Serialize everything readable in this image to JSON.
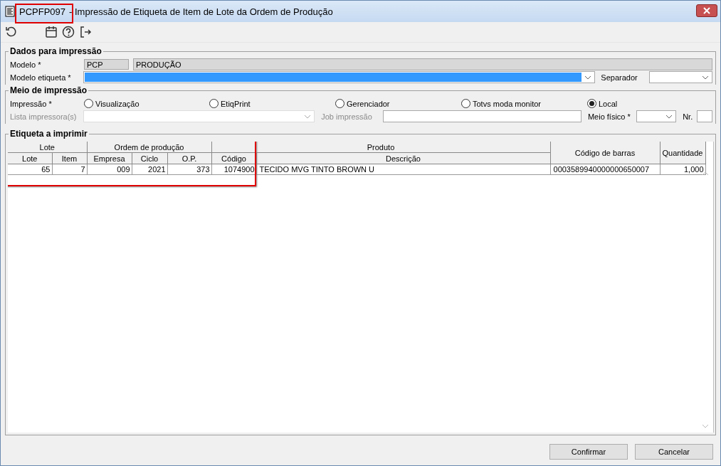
{
  "window": {
    "code": "PCPFP097",
    "code_highlighted": true,
    "title": "- Impressão de Etiqueta de Item de Lote da Ordem de Produção"
  },
  "dados": {
    "legend": "Dados para impressão",
    "modelo_label": "Modelo *",
    "modelo_code": "PCP",
    "modelo_name": "PRODUÇÃO",
    "etiqueta_label": "Modelo etiqueta *",
    "etiqueta_selected": true,
    "separador_label": "Separador"
  },
  "meio": {
    "legend": "Meio de impressão",
    "impressao_label": "Impressão *",
    "options": [
      {
        "label": "Visualização",
        "selected": false
      },
      {
        "label": "EtiqPrint",
        "selected": false
      },
      {
        "label": "Gerenciador",
        "selected": false
      },
      {
        "label": "Totvs moda monitor",
        "selected": false
      },
      {
        "label": "Local",
        "selected": true
      }
    ],
    "lista_label": "Lista impressora(s)",
    "lista_disabled": true,
    "job_label": "Job impressão",
    "meio_fisico_label": "Meio físico *",
    "nr_label": "Nr."
  },
  "table": {
    "legend": "Etiqueta a imprimir",
    "highlighted": true,
    "group_headers": [
      "Lote",
      "Ordem de produção",
      "Produto"
    ],
    "columns": [
      "Lote",
      "Item",
      "Empresa",
      "Ciclo",
      "O.P.",
      "Código",
      "Descrição",
      "Código de barras",
      "Quantidade"
    ],
    "rows": [
      [
        "65",
        "7",
        "009",
        "2021",
        "373",
        "1074900",
        "TECIDO MVG TINTO BROWN U",
        "0003589940000000650007",
        "1,000"
      ]
    ]
  },
  "buttons": [
    "Confirmar",
    "Cancelar"
  ]
}
